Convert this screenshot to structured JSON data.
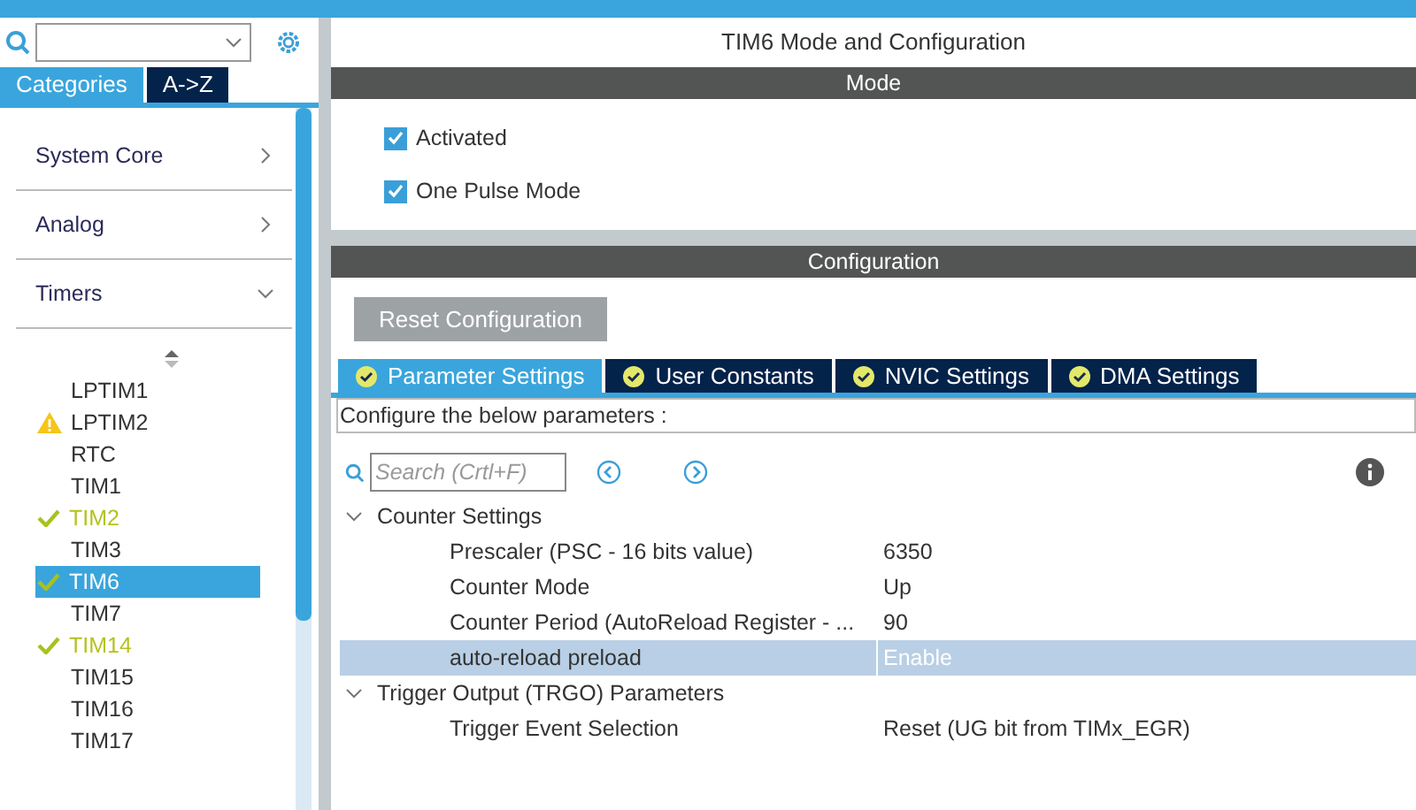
{
  "sidebar": {
    "tabs": [
      {
        "label": "Categories",
        "selected": true
      },
      {
        "label": "A->Z",
        "selected": false
      }
    ],
    "categories": [
      {
        "label": "System Core",
        "expanded": false
      },
      {
        "label": "Analog",
        "expanded": false
      },
      {
        "label": "Timers",
        "expanded": true
      }
    ],
    "items": [
      {
        "label": "LPTIM1",
        "kind": "plain",
        "selected": false
      },
      {
        "label": "LPTIM2",
        "kind": "warning",
        "selected": false
      },
      {
        "label": "RTC",
        "kind": "plain",
        "selected": false
      },
      {
        "label": "TIM1",
        "kind": "plain",
        "selected": false
      },
      {
        "label": "TIM2",
        "kind": "configured",
        "selected": false
      },
      {
        "label": "TIM3",
        "kind": "plain",
        "selected": false
      },
      {
        "label": "TIM6",
        "kind": "configured",
        "selected": true
      },
      {
        "label": "TIM7",
        "kind": "plain",
        "selected": false
      },
      {
        "label": "TIM14",
        "kind": "configured",
        "selected": false
      },
      {
        "label": "TIM15",
        "kind": "plain",
        "selected": false
      },
      {
        "label": "TIM16",
        "kind": "plain",
        "selected": false
      },
      {
        "label": "TIM17",
        "kind": "plain",
        "selected": false
      }
    ]
  },
  "main": {
    "title": "TIM6 Mode and Configuration",
    "mode_header": "Mode",
    "mode_options": [
      {
        "label": "Activated",
        "checked": true
      },
      {
        "label": "One Pulse Mode",
        "checked": true
      }
    ],
    "config_header": "Configuration",
    "reset_button": "Reset Configuration",
    "tabs": [
      {
        "label": "Parameter Settings",
        "selected": true
      },
      {
        "label": "User Constants",
        "selected": false
      },
      {
        "label": "NVIC Settings",
        "selected": false
      },
      {
        "label": "DMA Settings",
        "selected": false
      }
    ],
    "hint": "Configure the below parameters :",
    "search": {
      "placeholder": "Search (Crtl+F)"
    },
    "groups": [
      {
        "label": "Counter Settings",
        "expanded": true,
        "params": [
          {
            "name": "Prescaler (PSC - 16 bits value)",
            "value": "6350",
            "selected": false
          },
          {
            "name": "Counter Mode",
            "value": "Up",
            "selected": false
          },
          {
            "name": "Counter Period (AutoReload Register - ...",
            "value": "90",
            "selected": false
          },
          {
            "name": "auto-reload preload",
            "value": "Enable",
            "selected": true
          }
        ]
      },
      {
        "label": "Trigger Output (TRGO) Parameters",
        "expanded": true,
        "params": [
          {
            "name": "Trigger Event Selection",
            "value": "Reset (UG bit from TIMx_EGR)",
            "selected": false
          }
        ]
      }
    ]
  }
}
